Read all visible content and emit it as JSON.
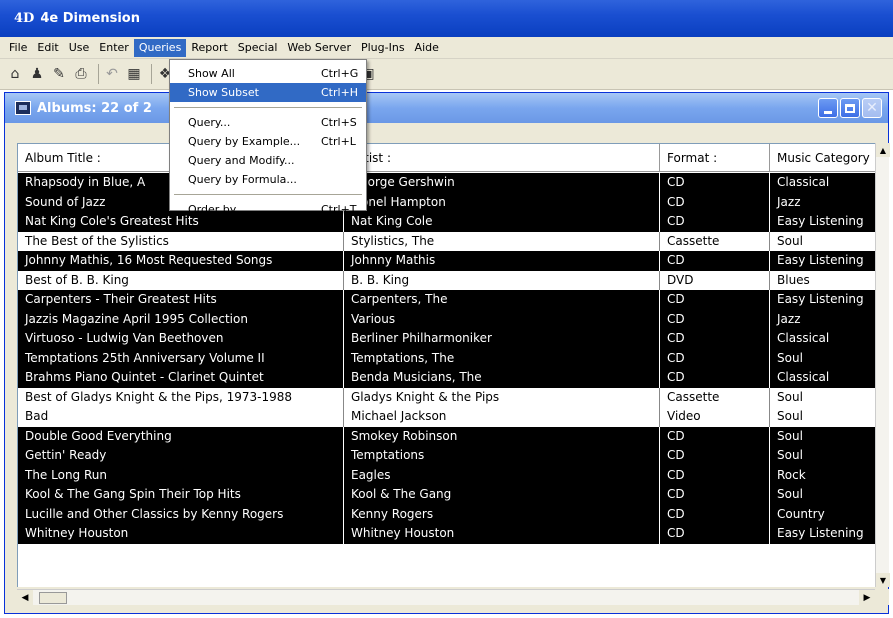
{
  "app": {
    "logo": "4D",
    "title": "4e Dimension"
  },
  "menubar": {
    "items": [
      "File",
      "Edit",
      "Use",
      "Enter",
      "Queries",
      "Report",
      "Special",
      "Web Server",
      "Plug-Ins",
      "Aide"
    ],
    "active": "Queries"
  },
  "toolbar": {
    "icons": [
      "open-folder-icon",
      "bucket-icon",
      "brush-icon",
      "printer-icon",
      "undo-icon",
      "table-icon",
      "cubes-icon",
      "tools-icon",
      "binoculars-icon",
      "magnifier-icon",
      "search-stack-icon",
      "chart-icon",
      "palette-icon",
      "key-icon",
      "document-icon"
    ]
  },
  "dropdown": {
    "items": [
      {
        "label": "Show All",
        "shortcut": "Ctrl+G",
        "highlighted": false
      },
      {
        "label": "Show Subset",
        "shortcut": "Ctrl+H",
        "highlighted": true
      },
      {
        "separator": true
      },
      {
        "label": "Query...",
        "shortcut": "Ctrl+S"
      },
      {
        "label": "Query by Example...",
        "shortcut": "Ctrl+L"
      },
      {
        "label": "Query and Modify...",
        "shortcut": ""
      },
      {
        "label": "Query by Formula...",
        "shortcut": ""
      },
      {
        "separator": true
      },
      {
        "label": "Order by...",
        "shortcut": "Ctrl+T"
      }
    ]
  },
  "window": {
    "title": "Albums: 22 of 2",
    "columns": [
      "Album Title :",
      "Artist :",
      "Format :",
      "Music Category :"
    ],
    "rows": [
      {
        "title": "Rhapsody in Blue, A",
        "artist": "George Gershwin",
        "format": "CD",
        "category": "Classical",
        "selected": true
      },
      {
        "title": "Sound of Jazz",
        "artist": "Lionel Hampton",
        "format": "CD",
        "category": "Jazz",
        "selected": true
      },
      {
        "title": "Nat King Cole's Greatest Hits",
        "artist": "Nat King Cole",
        "format": "CD",
        "category": "Easy Listening",
        "selected": true
      },
      {
        "title": "The Best of the Sylistics",
        "artist": "Stylistics, The",
        "format": "Cassette",
        "category": "Soul",
        "selected": false
      },
      {
        "title": "Johnny Mathis, 16 Most Requested Songs",
        "artist": "Johnny Mathis",
        "format": "CD",
        "category": "Easy Listening",
        "selected": true
      },
      {
        "title": "Best of B. B. King",
        "artist": "B. B. King",
        "format": "DVD",
        "category": "Blues",
        "selected": false
      },
      {
        "title": "Carpenters - Their Greatest Hits",
        "artist": "Carpenters, The",
        "format": "CD",
        "category": "Easy Listening",
        "selected": true
      },
      {
        "title": "Jazzis Magazine April 1995 Collection",
        "artist": "Various",
        "format": "CD",
        "category": "Jazz",
        "selected": true
      },
      {
        "title": "Virtuoso - Ludwig Van Beethoven",
        "artist": "Berliner Philharmoniker",
        "format": "CD",
        "category": "Classical",
        "selected": true
      },
      {
        "title": "Temptations 25th Anniversary Volume II",
        "artist": "Temptations, The",
        "format": "CD",
        "category": "Soul",
        "selected": true
      },
      {
        "title": "Brahms Piano Quintet - Clarinet Quintet",
        "artist": "Benda Musicians, The",
        "format": "CD",
        "category": "Classical",
        "selected": true
      },
      {
        "title": "Best of Gladys Knight & the Pips, 1973-1988",
        "artist": "Gladys Knight & the Pips",
        "format": "Cassette",
        "category": "Soul",
        "selected": false
      },
      {
        "title": "Bad",
        "artist": "Michael Jackson",
        "format": "Video",
        "category": "Soul",
        "selected": false
      },
      {
        "title": "Double Good Everything",
        "artist": "Smokey Robinson",
        "format": "CD",
        "category": "Soul",
        "selected": true
      },
      {
        "title": "Gettin' Ready",
        "artist": "Temptations",
        "format": "CD",
        "category": "Soul",
        "selected": true
      },
      {
        "title": "The Long Run",
        "artist": "Eagles",
        "format": "CD",
        "category": "Rock",
        "selected": true
      },
      {
        "title": "Kool & The Gang Spin Their Top Hits",
        "artist": "Kool & The Gang",
        "format": "CD",
        "category": "Soul",
        "selected": true
      },
      {
        "title": "Lucille and Other Classics by Kenny Rogers",
        "artist": "Kenny Rogers",
        "format": "CD",
        "category": "Country",
        "selected": true
      },
      {
        "title": "Whitney Houston",
        "artist": "Whitney Houston",
        "format": "CD",
        "category": "Easy Listening",
        "selected": true
      }
    ]
  },
  "colors": {
    "title_bar": "#0a3fc0",
    "menu_highlight": "#316ac5",
    "selected_row": "#000000",
    "chrome": "#ece9d8"
  }
}
